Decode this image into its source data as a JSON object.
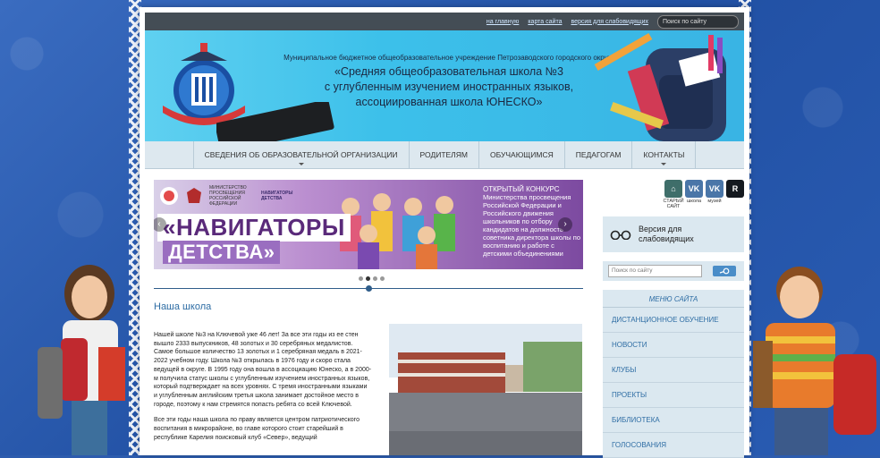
{
  "topbar": {
    "links": [
      "на главную",
      "карта сайта",
      "версия для слабовидящих"
    ],
    "search_placeholder": "Поиск по сайту"
  },
  "header": {
    "org_line": "Муниципальное бюджетное общеобразовательное учреждение Петрозаводского городского округа",
    "title_lines": [
      "«Средняя общеобразовательная школа №3",
      "с углубленным изучением иностранных языков,",
      "ассоциированная школа ЮНЕСКО»"
    ]
  },
  "nav": {
    "items": [
      "Сведения об образовательной организации",
      "Родителям",
      "Обучающимся",
      "Педагогам",
      "Контакты"
    ]
  },
  "banner": {
    "logo1": "МИНИСТЕРСТВО ПРОСВЕЩЕНИЯ РОССИЙСКОЙ ФЕДЕРАЦИИ",
    "logo2": "НАВИГАТОРЫ ДЕТСТВА",
    "headline1": "«НАВИГАТОРЫ",
    "headline2": "ДЕТСТВА»",
    "right_heading": "ОТКРЫТЫЙ КОНКУРС",
    "right_text": "Министерства просвещения Российской Федерации и Российского движения школьников по отбору кандидатов на должность советника директора школы по воспитанию и работе с детскими объединениями"
  },
  "section": {
    "title": "Наша школа"
  },
  "article": {
    "p1": "Нашей школе №3 на Ключевой уже 46 лет! За все эти годы из ее стен вышло 2333 выпускников, 48 золотых и 30 серебряных медалистов. Самое большое количество 13 золотых и 1 серебряная медаль в 2021-2022 учебном году. Школа №3 открылась в 1976 году и скоро стала ведущей в округе. В 1995 году она вошла в ассоциацию Юнеско, а в 2000-м получила статус школы с углубленным изучением иностранных языков, который подтверждает на всех уровнях. С тремя иностранными языками и углубленным английским третья школа занимает достойное место в городе, поэтому к нам стремятся попасть ребята со всей Ключевой.",
    "p2": "Все эти годы наша школа по праву является центром патриотического воспитания в микрорайоне, во главе которого стоит старейший в республике Карелия  поисковый клуб «Север», ведущий"
  },
  "sidebar": {
    "social": [
      {
        "label": "СТАРЫЙ САЙТ",
        "icon": "old-site-icon",
        "color": "#3f6e6a"
      },
      {
        "label": "школа",
        "icon": "vk-icon",
        "color": "#4a76a8"
      },
      {
        "label": "музей",
        "icon": "vk-icon",
        "color": "#4a76a8"
      },
      {
        "label": "",
        "icon": "rutube-icon",
        "color": "#14191f"
      }
    ],
    "vision_label_1": "Версия для",
    "vision_label_2": "слабовидящих",
    "search_placeholder": "Поиск по сайту",
    "menu_title": "МЕНЮ САЙТА",
    "menu_items": [
      "Дистанционное обучение",
      "Новости",
      "Клубы",
      "Проекты",
      "Библиотека",
      "Голосования"
    ]
  }
}
